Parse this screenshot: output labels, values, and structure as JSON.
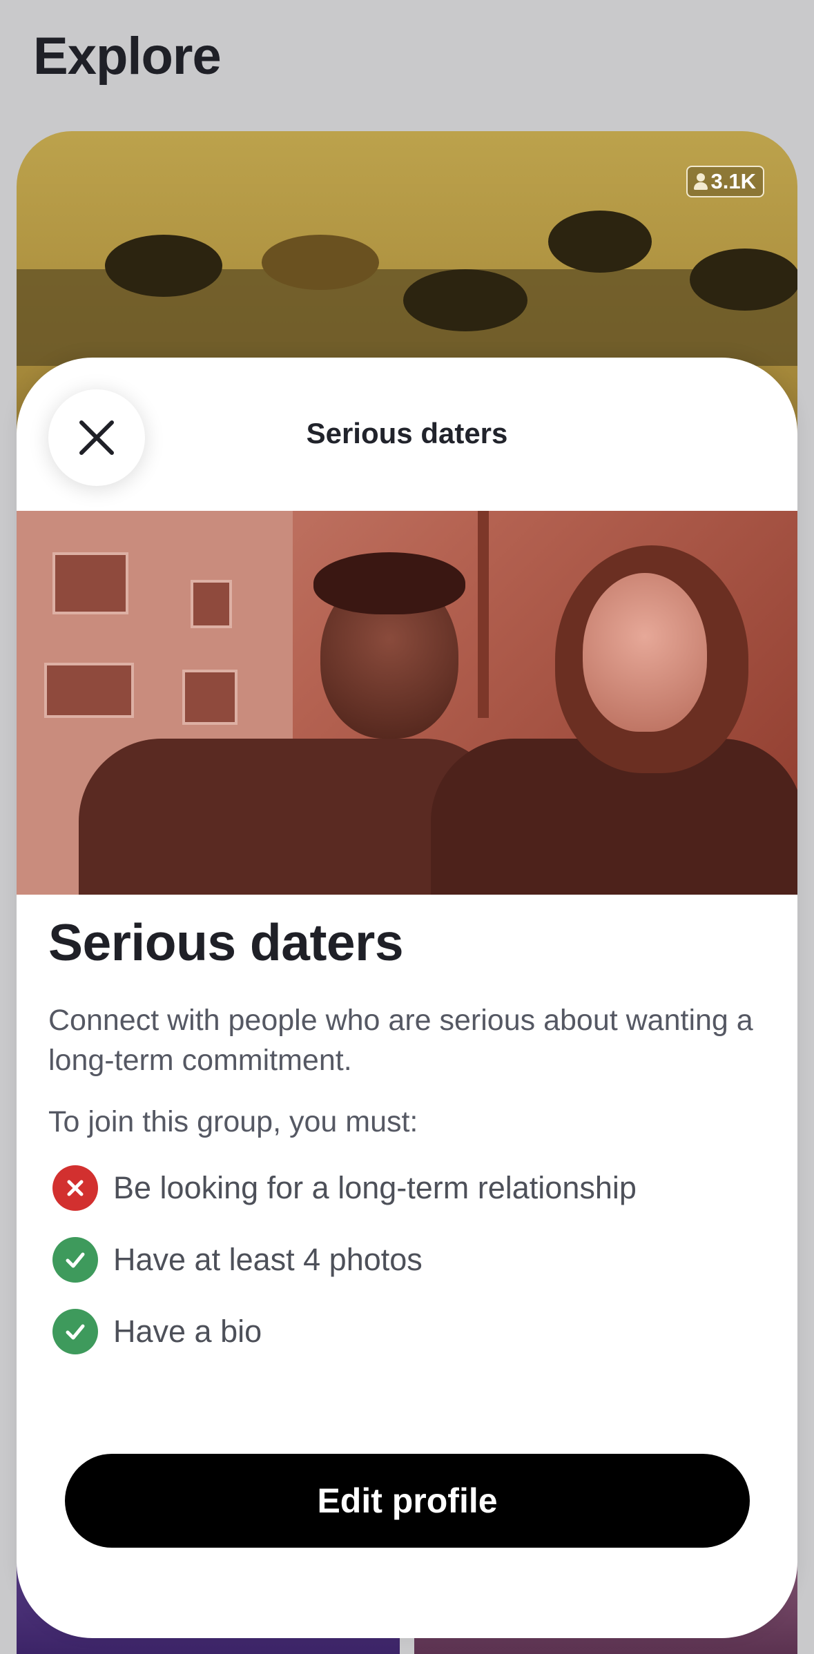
{
  "header": {
    "title": "Explore"
  },
  "background_card": {
    "member_count": "3.1K"
  },
  "sheet": {
    "header_title": "Serious daters",
    "title": "Serious daters",
    "description": "Connect with people who are serious about wanting a long-term commitment.",
    "requirements_intro": "To join this group, you must:",
    "requirements": [
      {
        "label": "Be looking for a long-term relationship",
        "status": "fail",
        "icon": "x-icon"
      },
      {
        "label": "Have at least 4 photos",
        "status": "pass",
        "icon": "check-icon"
      },
      {
        "label": "Have a bio",
        "status": "pass",
        "icon": "check-icon"
      }
    ],
    "cta_label": "Edit profile"
  },
  "colors": {
    "fail": "#d2302f",
    "pass": "#3e9a5c",
    "cta_bg": "#000000",
    "hero_tint": "#b56352"
  }
}
